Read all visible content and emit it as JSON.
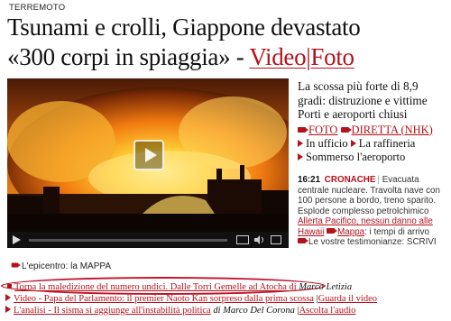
{
  "kicker": "TERREMOTO",
  "headline": {
    "line1": "Tsunami e crolli, Giappone devastato",
    "line2": "«300 corpi in spiaggia» -",
    "video": "Video",
    "separator": "|",
    "photo": "Foto"
  },
  "video_player": {
    "play_icon": "play-icon"
  },
  "summary": "La scossa più forte di 8,9 gradi: distruzione e vittime Porti e aeroporti chiusi",
  "side_links": {
    "foto": "FOTO",
    "diretta": "DIRETTA (NHK)",
    "ufficio": "In ufficio",
    "raffineria": "La raffineria",
    "aeroporto": "Sommerso l'aeroporto"
  },
  "live": {
    "time": "16:21",
    "tag": "CRONACHE",
    "text": "Evacuata centrale nucleare. Travolta nave con 100 persone a bordo, treno sparito. Esplode complesso petrolchimico",
    "alert_link": "Allerta Pacifico, nessun danno alle Hawaii",
    "map_link": "Mappa",
    "map_text": ": i tempi di arrivo",
    "testimonials": "Le vostre testimonianze: SCRIVI"
  },
  "caption": "L'epicentro: la MAPPA",
  "bottom_links": {
    "l1_link": "Torna la maledizione del numero undici. Dalle Torri Gemelle ad Atocha di",
    "l1_author": "Marco Letizia",
    "l2_link1": "Video - Papa del Parlamento: il premier Naoto Kan sorpreso dalla prima scossa",
    "l2_sep": "|",
    "l2_link2": "Guarda il video",
    "l3_link1": "L'analisi - Il sisma si aggiunge all'instabilità politica",
    "l3_author_prefix": "di",
    "l3_author": "Marco Del Corona",
    "l3_sep": "|",
    "l3_link2": "Ascolta l'audio"
  },
  "colors": {
    "accent": "#b5121b",
    "circle": "#c0142a"
  }
}
